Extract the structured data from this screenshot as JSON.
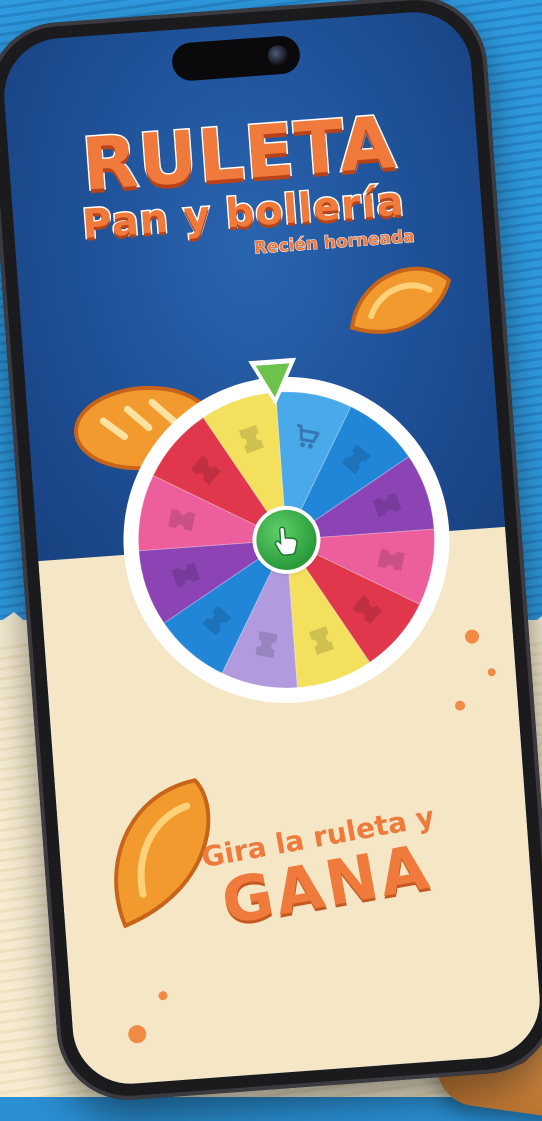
{
  "title": {
    "main": "RULETA",
    "sub": "Pan y bollería",
    "tagline": "Recién horneada"
  },
  "wheel": {
    "segments": [
      {
        "color": "#4aa9e8",
        "icon": "cart-icon"
      },
      {
        "color": "#2286d8",
        "icon": "ticket-icon"
      },
      {
        "color": "#8c44b5",
        "icon": "ticket-icon"
      },
      {
        "color": "#ec5e9c",
        "icon": "ticket-icon"
      },
      {
        "color": "#e0374d",
        "icon": "ticket-icon"
      },
      {
        "color": "#f3e05c",
        "icon": "ticket-icon"
      },
      {
        "color": "#b29adf",
        "icon": "ticket-icon"
      },
      {
        "color": "#2286d8",
        "icon": "ticket-icon"
      },
      {
        "color": "#8c44b5",
        "icon": "ticket-icon"
      },
      {
        "color": "#ec5e9c",
        "icon": "ticket-icon"
      },
      {
        "color": "#e0374d",
        "icon": "ticket-icon"
      },
      {
        "color": "#f3e05c",
        "icon": "ticket-icon"
      }
    ],
    "spin_icon": "hand-pointer-icon",
    "pointer_color": "#6cc24a"
  },
  "cta": {
    "line1": "Gira la ruleta y",
    "line2": "GANA"
  },
  "colors": {
    "accent": "#f07a3c",
    "screen_blue": "#1e4f95",
    "cream": "#f5e6c6"
  }
}
